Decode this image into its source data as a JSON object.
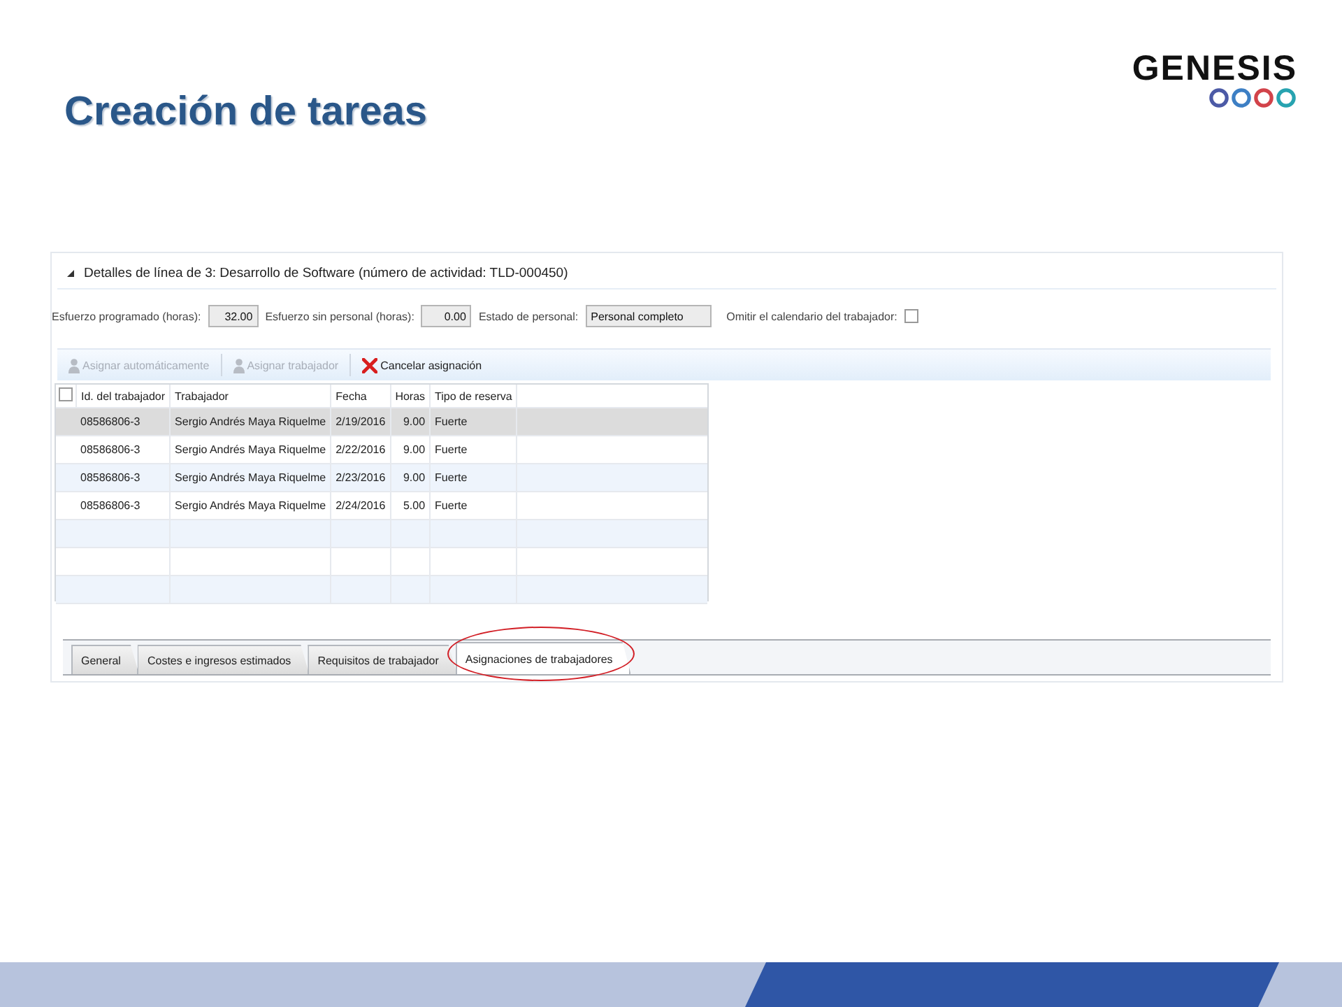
{
  "slide": {
    "title": "Creación de tareas",
    "logo": "GENESIS"
  },
  "panel": {
    "section_title": "Detalles de línea de 3: Desarrollo de Software (número de actividad: TLD-000450)",
    "expanded": true,
    "fields": [
      {
        "kind": "number",
        "label": "Esfuerzo programado (horas):",
        "value": "32.00"
      },
      {
        "kind": "number",
        "label": "Esfuerzo sin personal (horas):",
        "value": "0.00"
      },
      {
        "kind": "text",
        "label": "Estado de personal:",
        "value": "Personal completo"
      },
      {
        "kind": "checkbox",
        "label": "Omitir el calendario del trabajador:",
        "checked": false
      }
    ],
    "toolbar": [
      {
        "kind": "person",
        "label": "Asignar automáticamente",
        "disabled": true
      },
      {
        "kind": "person",
        "label": "Asignar trabajador",
        "disabled": true
      },
      {
        "kind": "cross",
        "label": "Cancelar asignación",
        "disabled": false
      }
    ],
    "grid": {
      "select_all_checked": false,
      "columns": [
        {
          "label": "Id. del trabajador",
          "kind": "text"
        },
        {
          "label": "Trabajador",
          "kind": "text"
        },
        {
          "label": "Fecha",
          "kind": "text"
        },
        {
          "label": "Horas",
          "kind": "number"
        },
        {
          "label": "Tipo de reserva",
          "kind": "text"
        }
      ],
      "rows": [
        {
          "selected": true,
          "cells": [
            "08586806-3",
            "Sergio Andrés Maya Riquelme",
            "2/19/2016",
            "9.00",
            "Fuerte"
          ]
        },
        {
          "selected": false,
          "cells": [
            "08586806-3",
            "Sergio Andrés Maya Riquelme",
            "2/22/2016",
            "9.00",
            "Fuerte"
          ]
        },
        {
          "selected": false,
          "cells": [
            "08586806-3",
            "Sergio Andrés Maya Riquelme",
            "2/23/2016",
            "9.00",
            "Fuerte"
          ]
        },
        {
          "selected": false,
          "cells": [
            "08586806-3",
            "Sergio Andrés Maya Riquelme",
            "2/24/2016",
            "5.00",
            "Fuerte"
          ]
        }
      ]
    },
    "tabs": [
      {
        "label": "General",
        "selected": false,
        "circled": false
      },
      {
        "label": "Costes e ingresos estimados",
        "selected": false,
        "circled": false
      },
      {
        "label": "Requisitos de trabajador",
        "selected": false,
        "circled": false
      },
      {
        "label": "Asignaciones de trabajadores",
        "selected": true,
        "circled": true
      }
    ]
  }
}
